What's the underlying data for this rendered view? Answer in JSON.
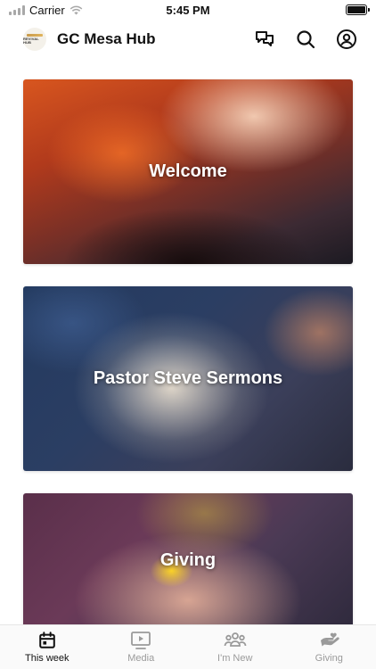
{
  "status_bar": {
    "carrier": "Carrier",
    "time": "5:45 PM"
  },
  "header": {
    "title": "GC Mesa Hub",
    "logo_text": "REVIVAL HUB",
    "icons": [
      "chat-icon",
      "search-icon",
      "profile-icon"
    ]
  },
  "cards": [
    {
      "title": "Welcome"
    },
    {
      "title": "Pastor Steve Sermons"
    },
    {
      "title": "Giving"
    }
  ],
  "tabs": [
    {
      "label": "This week",
      "icon": "calendar-icon",
      "active": true
    },
    {
      "label": "Media",
      "icon": "video-icon",
      "active": false
    },
    {
      "label": "I'm New",
      "icon": "people-icon",
      "active": false
    },
    {
      "label": "Giving",
      "icon": "giving-hand-icon",
      "active": false
    }
  ],
  "colors": {
    "active_tab": "#111111",
    "inactive_tab": "#9a9a9a"
  }
}
